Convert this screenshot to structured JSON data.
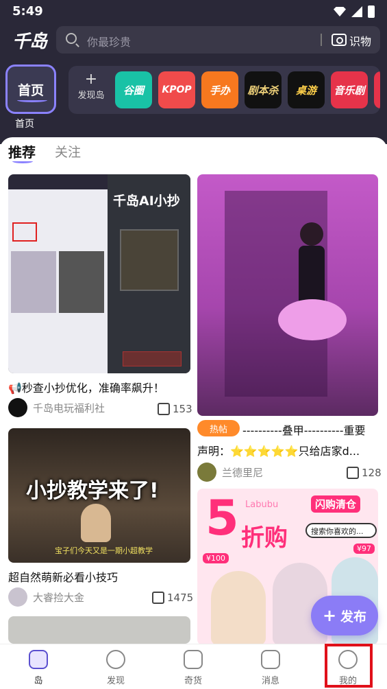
{
  "status": {
    "time": "5:49"
  },
  "header": {
    "logo": "千岛",
    "search_placeholder": "你最珍贵",
    "shiwu_label": "识物"
  },
  "home": {
    "tile_label": "首页",
    "label": "首页"
  },
  "categories": {
    "discover": "发现岛",
    "items": [
      {
        "label": "谷圈",
        "color": "#19c2a6"
      },
      {
        "label": "KPOP",
        "color": "#f04b4b"
      },
      {
        "label": "手办",
        "color": "#f7781f"
      },
      {
        "label": "剧本杀",
        "color": "#111111"
      },
      {
        "label": "桌游",
        "color": "#111111"
      },
      {
        "label": "音乐剧",
        "color": "#e6334a"
      }
    ]
  },
  "tabs": {
    "recommend": "推荐",
    "follow": "关注"
  },
  "feed": {
    "left": [
      {
        "image_text": "千岛AI小抄",
        "title": "📢秒查小抄优化，准确率飙升！",
        "author": "千岛电玩福利社",
        "likes": "153"
      },
      {
        "image_text": "小抄教学来了!",
        "image_sub": "宝子们今天又是一期小超教学",
        "title": "超自然萌新必看小技巧",
        "author": "大睿捡大金",
        "likes": "1475"
      }
    ],
    "right": [
      {
        "hot_badge": "热帖",
        "title_line1": "----------叠甲----------重要",
        "title_line2": "声明：⭐⭐⭐⭐⭐只给店家d...",
        "author": "兰德里尼",
        "likes": "128"
      },
      {
        "image_big": "5",
        "image_text": "折购",
        "image_brand": "Labubu",
        "image_flash": "闪购清仓",
        "image_search": "搜索你喜欢的...",
        "image_price1": "¥100",
        "image_price2": "¥97"
      }
    ]
  },
  "fab": {
    "label": "发布"
  },
  "nav": [
    "岛",
    "发现",
    "奇货",
    "消息",
    "我的"
  ]
}
